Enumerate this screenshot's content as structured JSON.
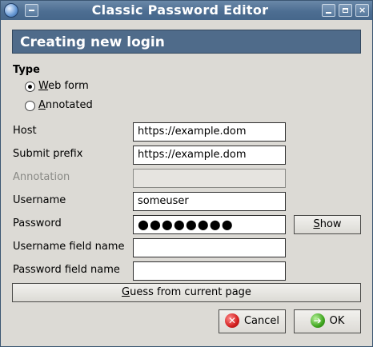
{
  "window": {
    "title": "Classic Password Editor",
    "close_glyph": "×"
  },
  "banner": {
    "title": "Creating new login"
  },
  "type_section": {
    "title": "Type",
    "options": [
      {
        "first_letter": "W",
        "rest": "eb form",
        "checked": true
      },
      {
        "first_letter": "A",
        "rest": "nnotated",
        "checked": false
      }
    ]
  },
  "fields": {
    "host": {
      "label": "Host",
      "value": "https://example.dom"
    },
    "submit_prefix": {
      "label": "Submit prefix",
      "value": "https://example.dom"
    },
    "annotation": {
      "label": "Annotation",
      "value": "",
      "enabled": false
    },
    "username": {
      "label": "Username",
      "value": "someuser"
    },
    "password": {
      "label": "Password",
      "masked_value": "●●●●●●●●"
    },
    "username_field_name": {
      "label": "Username field name",
      "value": ""
    },
    "password_field_name": {
      "label": "Password field name",
      "value": ""
    }
  },
  "buttons": {
    "show": {
      "first_letter": "S",
      "rest": "how"
    },
    "guess": {
      "first_letter": "G",
      "rest": "uess from current page"
    },
    "cancel": {
      "label": "Cancel",
      "icon": "cancel-icon"
    },
    "ok": {
      "label": "OK",
      "icon": "ok-icon"
    }
  },
  "colors": {
    "titlebar": "#4d6e92",
    "banner": "#4f6b8a",
    "window_bg": "#dcdad5"
  }
}
